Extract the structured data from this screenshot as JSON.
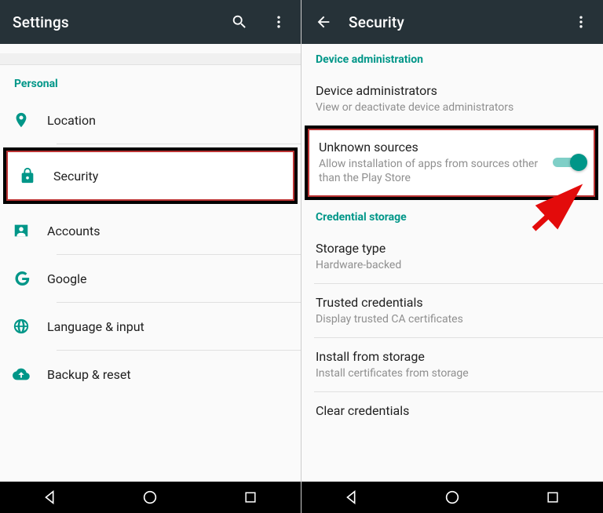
{
  "left": {
    "appbar_title": "Settings",
    "section_personal": "Personal",
    "items": [
      {
        "label": "Location"
      },
      {
        "label": "Security"
      },
      {
        "label": "Accounts"
      },
      {
        "label": "Google"
      },
      {
        "label": "Language & input"
      },
      {
        "label": "Backup & reset"
      }
    ]
  },
  "right": {
    "appbar_title": "Security",
    "section_device_admin": "Device administration",
    "device_admins": {
      "title": "Device administrators",
      "sub": "View or deactivate device administrators"
    },
    "unknown_sources": {
      "title": "Unknown sources",
      "sub": "Allow installation of apps from sources other than the Play Store",
      "toggle_on": true
    },
    "section_cred_storage": "Credential storage",
    "storage_type": {
      "title": "Storage type",
      "sub": "Hardware-backed"
    },
    "trusted_creds": {
      "title": "Trusted credentials",
      "sub": "Display trusted CA certificates"
    },
    "install_storage": {
      "title": "Install from storage",
      "sub": "Install certificates from storage"
    },
    "clear_creds": {
      "title": "Clear credentials"
    }
  }
}
